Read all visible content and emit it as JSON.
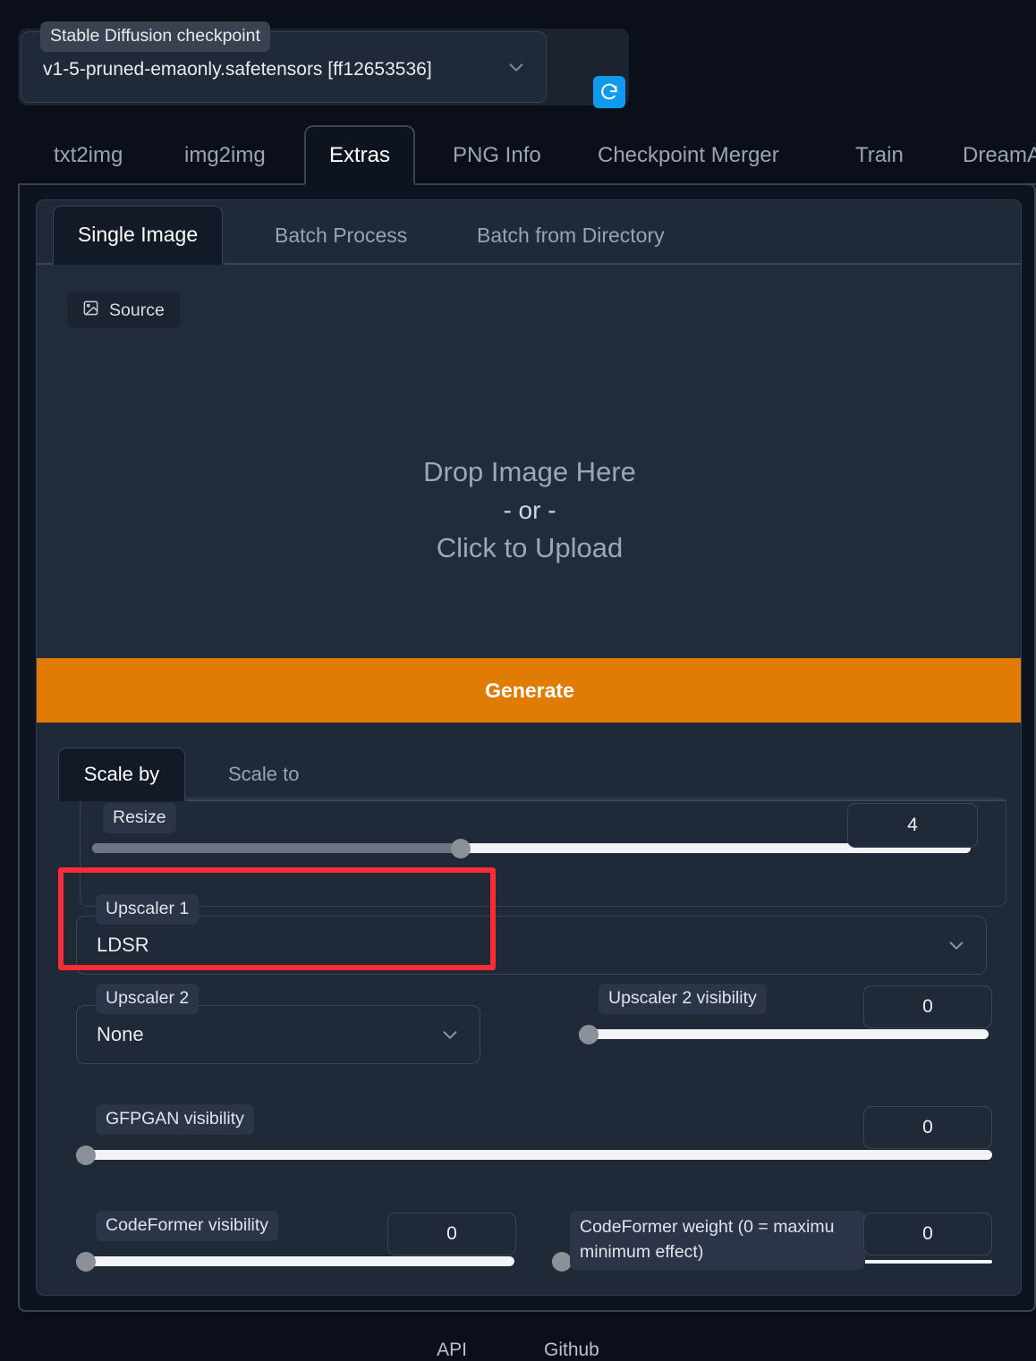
{
  "checkpoint": {
    "label": "Stable Diffusion checkpoint",
    "value": "v1-5-pruned-emaonly.safetensors [ff12653536]",
    "refresh_icon": "refresh-icon",
    "chevron_icon": "chevron-down-icon"
  },
  "tabs": [
    {
      "label": "txt2img",
      "active": false
    },
    {
      "label": "img2img",
      "active": false
    },
    {
      "label": "Extras",
      "active": true
    },
    {
      "label": "PNG Info",
      "active": false
    },
    {
      "label": "Checkpoint Merger",
      "active": false
    },
    {
      "label": "Train",
      "active": false
    },
    {
      "label": "DreamA",
      "active": false
    }
  ],
  "subtabs": [
    {
      "label": "Single Image",
      "active": true
    },
    {
      "label": "Batch Process",
      "active": false
    },
    {
      "label": "Batch from Directory",
      "active": false
    }
  ],
  "source": {
    "button_label": "Source",
    "icon": "image-icon",
    "drop_line1": "Drop Image Here",
    "drop_line2": "- or -",
    "drop_line3": "Click to Upload"
  },
  "generate": {
    "label": "Generate"
  },
  "scale_tabs": [
    {
      "label": "Scale by",
      "active": true
    },
    {
      "label": "Scale to",
      "active": false
    }
  ],
  "resize": {
    "label": "Resize",
    "value": "4",
    "percent": 42
  },
  "upscaler1": {
    "label": "Upscaler 1",
    "value": "LDSR",
    "chevron_icon": "chevron-down-icon"
  },
  "upscaler2": {
    "label": "Upscaler 2",
    "value": "None",
    "chevron_icon": "chevron-down-icon"
  },
  "upscaler2_visibility": {
    "label": "Upscaler 2 visibility",
    "value": "0",
    "percent": 0
  },
  "gfpgan_visibility": {
    "label": "GFPGAN visibility",
    "value": "0",
    "percent": 0
  },
  "codeformer_visibility": {
    "label": "CodeFormer visibility",
    "value": "0",
    "percent": 0
  },
  "codeformer_weight": {
    "label": "CodeFormer weight (0 = maximu minimum effect)",
    "value": "0",
    "percent": 0
  },
  "footer": {
    "api_label": "API",
    "github_label": "Github"
  },
  "colors": {
    "accent_orange": "#e07b04",
    "refresh_blue": "#0f9aee",
    "annotation_red": "#fb2c36",
    "page_bg": "#0b0f19",
    "panel_bg": "#1f2937"
  }
}
